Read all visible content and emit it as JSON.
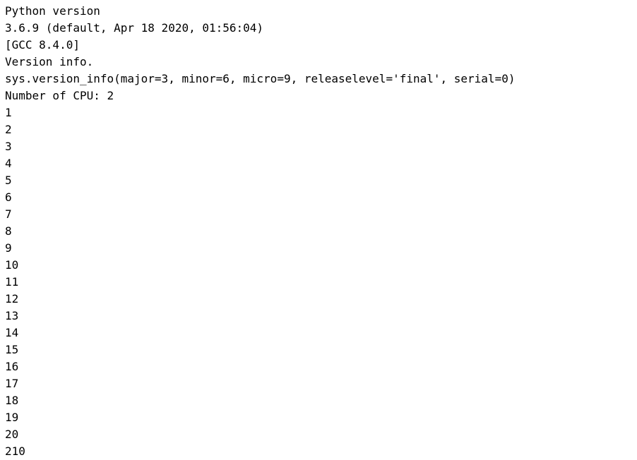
{
  "console": {
    "background_color": "#ffffff",
    "text_color": "#000000",
    "lines": [
      {
        "id": "header-python-version-label",
        "text": "Python version"
      },
      {
        "id": "python-version-string",
        "text": "3.6.9 (default, Apr 18 2020, 01:56:04)"
      },
      {
        "id": "compiler-string",
        "text": "[GCC 8.4.0]"
      },
      {
        "id": "header-version-info-label",
        "text": "Version info."
      },
      {
        "id": "sys-version-info-tuple",
        "text": "sys.version_info(major=3, minor=6, micro=9, releaselevel='final', serial=0)"
      },
      {
        "id": "cpu-count-line",
        "text": "Number of CPU: 2"
      },
      {
        "id": "counter-1",
        "text": "1"
      },
      {
        "id": "counter-2",
        "text": "2"
      },
      {
        "id": "counter-3",
        "text": "3"
      },
      {
        "id": "counter-4",
        "text": "4"
      },
      {
        "id": "counter-5",
        "text": "5"
      },
      {
        "id": "counter-6",
        "text": "6"
      },
      {
        "id": "counter-7",
        "text": "7"
      },
      {
        "id": "counter-8",
        "text": "8"
      },
      {
        "id": "counter-9",
        "text": "9"
      },
      {
        "id": "counter-10",
        "text": "10"
      },
      {
        "id": "counter-11",
        "text": "11"
      },
      {
        "id": "counter-12",
        "text": "12"
      },
      {
        "id": "counter-13",
        "text": "13"
      },
      {
        "id": "counter-14",
        "text": "14"
      },
      {
        "id": "counter-15",
        "text": "15"
      },
      {
        "id": "counter-16",
        "text": "16"
      },
      {
        "id": "counter-17",
        "text": "17"
      },
      {
        "id": "counter-18",
        "text": "18"
      },
      {
        "id": "counter-19",
        "text": "19"
      },
      {
        "id": "counter-20",
        "text": "20"
      },
      {
        "id": "final-total-line",
        "text": "210"
      }
    ]
  }
}
